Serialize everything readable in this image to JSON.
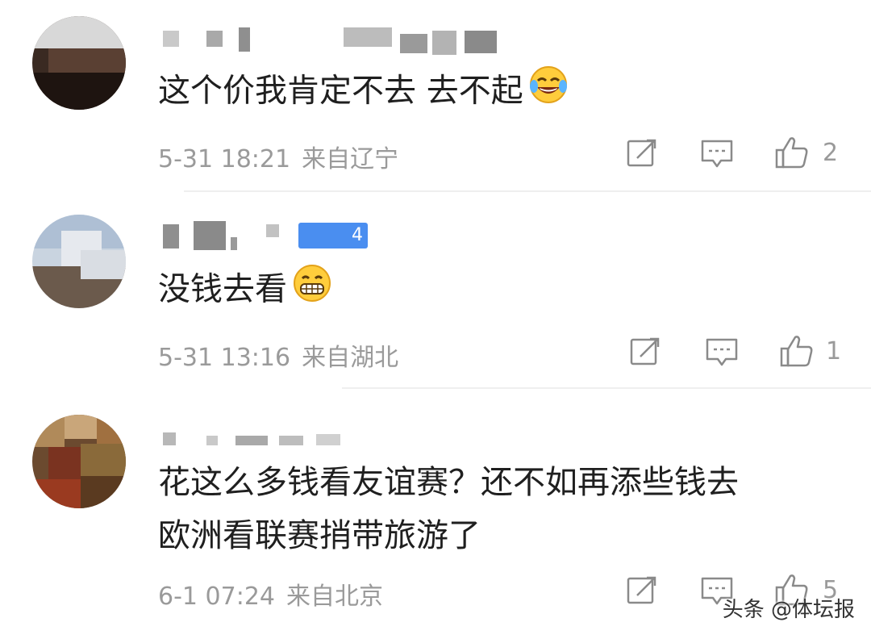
{
  "comments": [
    {
      "text": "这个价我肯定不去 去不起",
      "emoji": "laughing-tears-emoji",
      "time": "5-31 18:21",
      "location": "来自辽宁",
      "likes": "2"
    },
    {
      "text": "没钱去看",
      "emoji": "grinning-emoji",
      "badge": "4",
      "time": "5-31 13:16",
      "location": "来自湖北",
      "likes": "1"
    },
    {
      "text_line1": "花这么多钱看友谊赛？还不如再添些钱去",
      "text_line2": "欧洲看联赛捎带旅游了",
      "time": "6-1 07:24",
      "location": "来自北京",
      "likes": "5"
    }
  ],
  "watermark": "头条 @体坛报",
  "colors": {
    "meta": "#9a9a9a",
    "text": "#1f1f1f",
    "badge": "#4a8ef0",
    "divider": "#efefef"
  }
}
